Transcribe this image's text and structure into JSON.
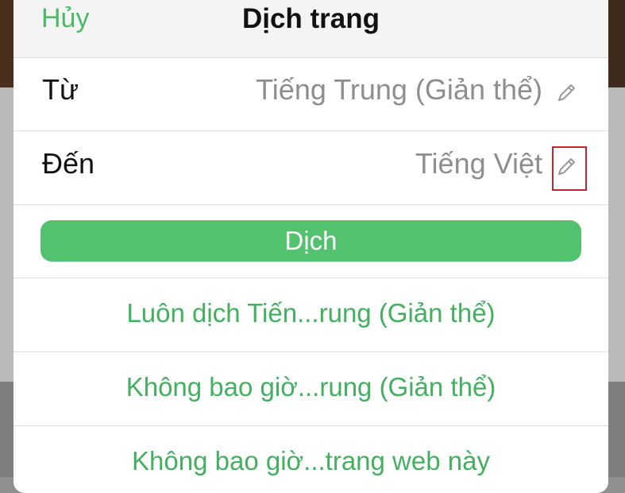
{
  "header": {
    "cancel_label": "Hủy",
    "title": "Dịch trang"
  },
  "from_row": {
    "label": "Từ",
    "value": "Tiếng Trung (Giản thể)",
    "edit_icon": "pencil-icon"
  },
  "to_row": {
    "label": "Đến",
    "value": "Tiếng Việt",
    "edit_icon": "pencil-icon",
    "highlighted": true
  },
  "translate_button": {
    "label": "Dịch"
  },
  "options": [
    {
      "label": "Luôn dịch Tiến...rung (Giản thể)"
    },
    {
      "label": "Không bao giờ...rung (Giản thể)"
    },
    {
      "label": "Không bao giờ...trang web này"
    }
  ],
  "colors": {
    "accent": "#4cba69",
    "button": "#52c26e",
    "highlight": "#c9252f"
  }
}
